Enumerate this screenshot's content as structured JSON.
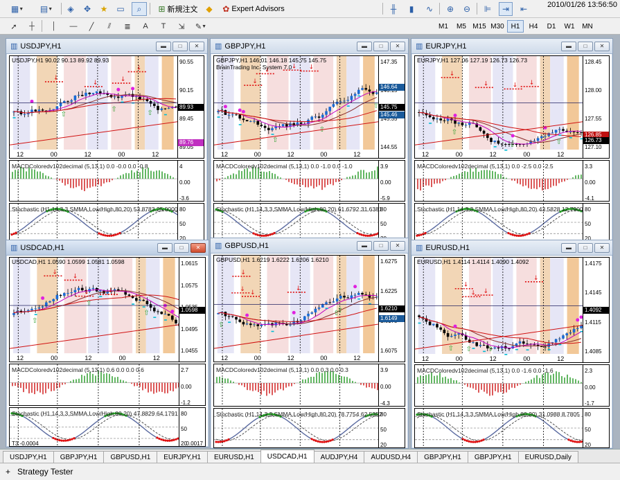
{
  "clock": "2010/01/26 13:56:50",
  "toolbar": {
    "new_order_label": "新規注文",
    "expert_advisors_label": "Expert Advisors",
    "timeframes": [
      "M1",
      "M5",
      "M15",
      "M30",
      "H1",
      "H4",
      "D1",
      "W1",
      "MN"
    ],
    "selected_timeframe": "H1"
  },
  "charts": [
    {
      "title": "USDJPY,H1",
      "info": "USDJPY,H1  90.02 90.13 89.92 89.93",
      "axis": [
        "90.55",
        "90.15",
        "89.45",
        "89.05"
      ],
      "price_box": "89.93",
      "price_box2": "89.76",
      "time_labels": [
        "12",
        "00",
        "12",
        "00",
        "12"
      ],
      "macd_label": "MACDColoredv102decimal (5,13,1) 0.0 -0.0 0.0 -0.8",
      "macd_axis": [
        "4",
        "0.00",
        "-3.6"
      ],
      "stoch_label": "Stochastic (H1,14,3,3,SMMA,Low/High,80,20) 53.8783 25.0000",
      "stoch_axis": [
        "80",
        "50",
        "20"
      ]
    },
    {
      "title": "GBPJPY,H1",
      "info": "GBPJPY,H1  146.01 146.18 145.75 145.75",
      "info2": "BrainTrading Inc. System 7.0",
      "axis": [
        "147.35",
        "146.15",
        "145.35",
        "144.55"
      ],
      "price_box": "146.64",
      "price_box2": "145.75",
      "price_box3": "145.46",
      "time_labels": [
        "12",
        "00",
        "12",
        "00",
        "12"
      ],
      "macd_label": "MACDColoredv102decimal (5,13,1) 0.0 -1.0 0.0 -1.0",
      "macd_axis": [
        "3.9",
        "0.00",
        "-5.9"
      ],
      "stoch_label": "Stochastic (H1,14,3,3,SMMA,Low/High,80,20) 61.6792 31.6381",
      "stoch_axis": [
        "80",
        "50",
        "20"
      ]
    },
    {
      "title": "EURJPY,H1",
      "info": "EURJPY,H1  127.06 127.19 126.73 126.73",
      "axis": [
        "128.45",
        "128.00",
        "127.55",
        "127.10"
      ],
      "price_box": "126.85",
      "price_box2": "126.73",
      "time_labels": [
        "12",
        "00",
        "12",
        "00",
        "12"
      ],
      "macd_label": "MACDColoredv102decimal (5,13,1) 0.0 -2.5 0.0 -2.5",
      "macd_axis": [
        "3.3",
        "0.00",
        "-4.1"
      ],
      "stoch_label": "Stochastic (H1,14,3,3,SMMA,Low/High,80,20) 43.5828 12.7900",
      "stoch_axis": [
        "80",
        "50",
        "20"
      ]
    },
    {
      "title": "USDCAD,H1",
      "info": "USDCAD,H1  1.0590 1.0599 1.0581 1.0598",
      "axis": [
        "1.0615",
        "1.0575",
        "1.0535",
        "1.0495",
        "1.0455"
      ],
      "price_box": "1.0598",
      "time_labels": [
        "12",
        "00",
        "12",
        "00",
        "12"
      ],
      "macd_label": "MACDColoredv102decimal (5,13,1) 0.6 0.0 0.0 0.6",
      "macd_axis": [
        "2.7",
        "0.00",
        "-1.2"
      ],
      "stoch_label": "Stochastic (H1,14,3,3,SMMA,Low/High,80,20) 47.8829 64.1791",
      "stoch_axis": [
        "80",
        "50",
        "20"
      ],
      "extra_label": "T3 -0.0004",
      "extra_axis": "0.0017"
    },
    {
      "title": "GBPUSD,H1",
      "info": "GBPUSD,H1  1.6219 1.6222 1.6206 1.6210",
      "axis": [
        "1.6275",
        "1.6225",
        "1.6175",
        "1.6075"
      ],
      "price_box": "1.6210",
      "price_box2": "1.6149",
      "time_labels": [
        "12",
        "00",
        "12",
        "00",
        "12"
      ],
      "macd_label": "MACDColoredv102decimal (5,13,1) 0.0 0.3 0.0 0.3",
      "macd_axis": [
        "3.9",
        "0.00",
        "-4.3"
      ],
      "stoch_label": "Stochastic (H1,14,3,3,SMMA,Low/High,80,20) 78.7754 62.5352",
      "stoch_axis": [
        "80",
        "50",
        "20"
      ]
    },
    {
      "title": "EURUSD,H1",
      "info": "EURUSD,H1  1.4114 1.4114 1.4090 1.4092",
      "axis": [
        "1.4175",
        "1.4145",
        "1.4115",
        "1.4085"
      ],
      "price_box": "1.4092",
      "time_labels": [
        "12",
        "00",
        "12",
        "00",
        "12"
      ],
      "macd_label": "MACDColoredv102decimal (5,13,1) 0.0 -1.6 0.0 -1.6",
      "macd_axis": [
        "2.3",
        "0.00",
        "-1.7"
      ],
      "stoch_label": "Stochastic (H1,14,3,3,SMMA,Low/High,80,20) 31.0988 8.7805",
      "stoch_axis": [
        "80",
        "50",
        "20"
      ]
    }
  ],
  "tabs": [
    "USDJPY,H1",
    "GBPJPY,H1",
    "GBPUSD,H1",
    "EURJPY,H1",
    "EURUSD,H1",
    "USDCAD,H1",
    "AUDJPY,H4",
    "AUDUSD,H4",
    "GBPJPY,H1",
    "GBPJPY,H1",
    "EURUSD,Daily"
  ],
  "active_tab": 5,
  "status": {
    "label": "Strategy Tester"
  }
}
